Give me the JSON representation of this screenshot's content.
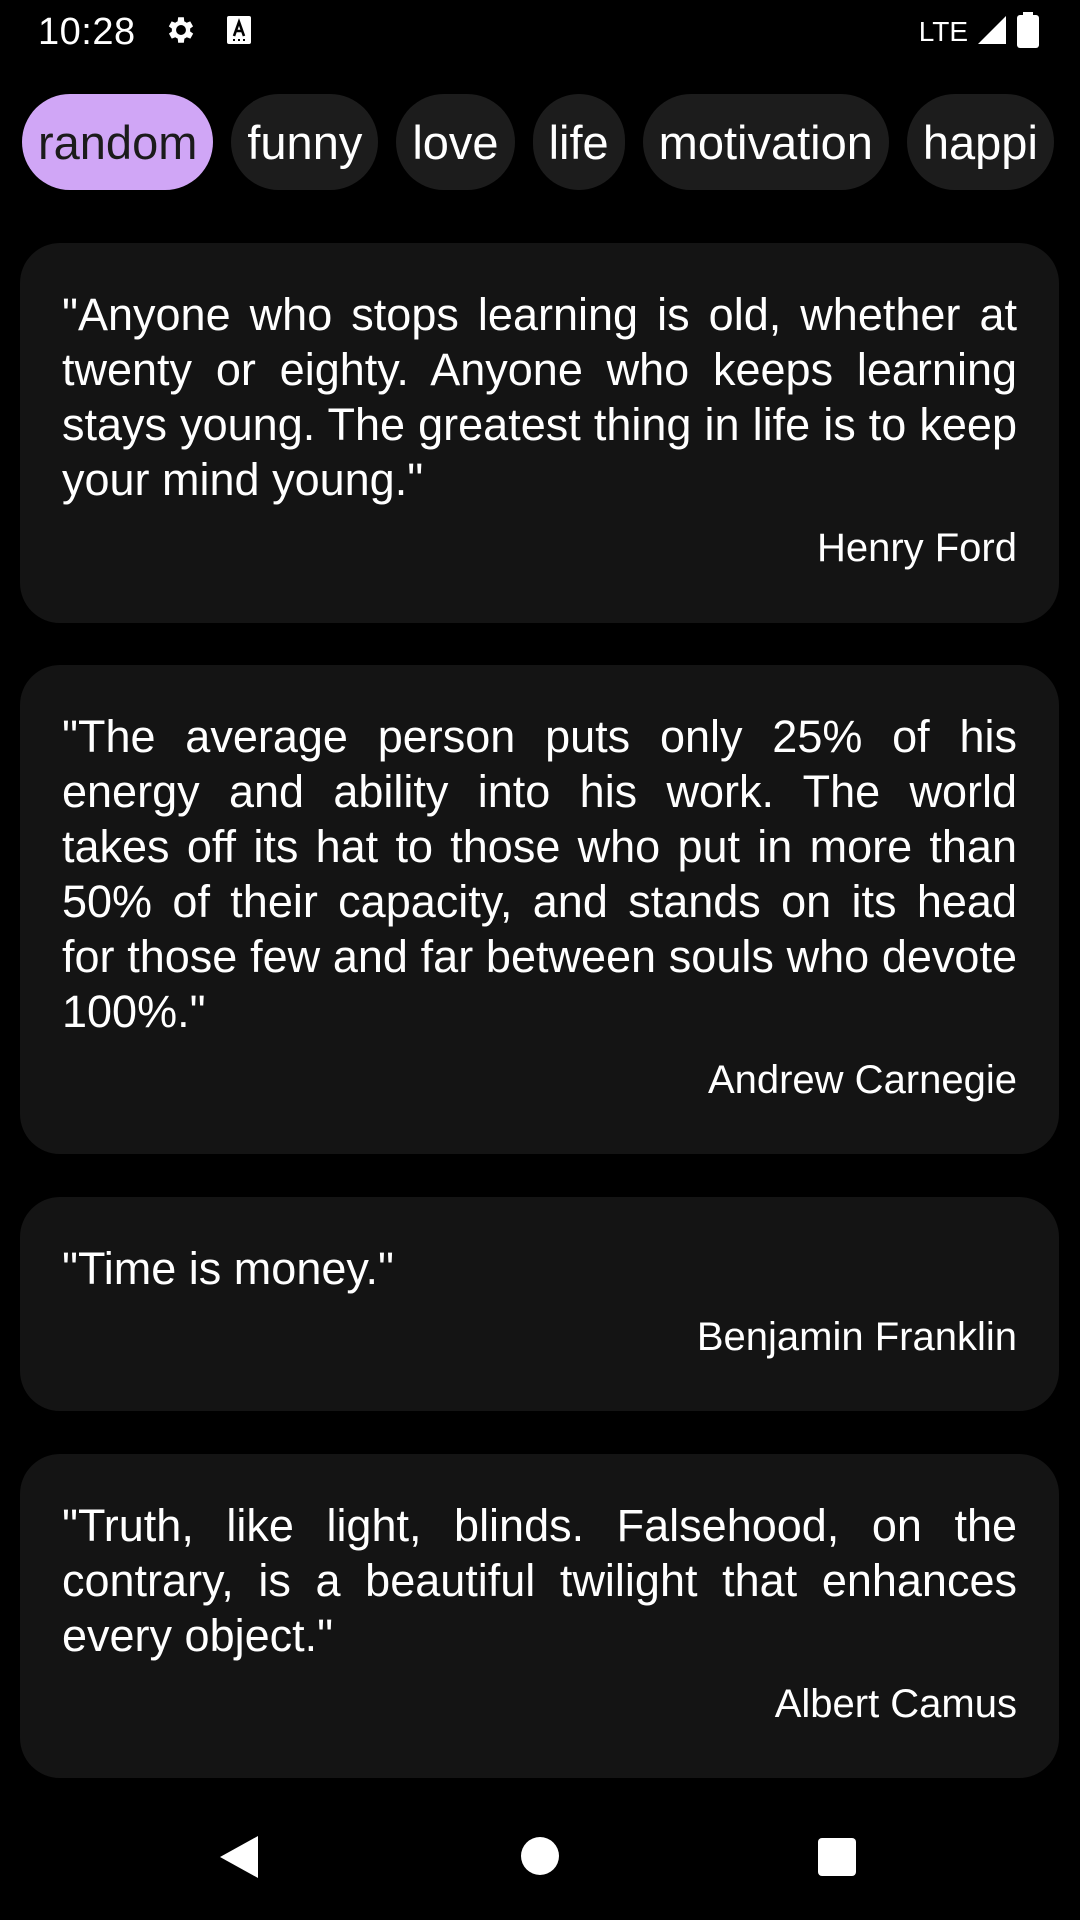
{
  "status_bar": {
    "time": "10:28",
    "network": "LTE"
  },
  "categories": [
    {
      "label": "random",
      "active": true
    },
    {
      "label": "funny",
      "active": false
    },
    {
      "label": "love",
      "active": false
    },
    {
      "label": "life",
      "active": false
    },
    {
      "label": "motivation",
      "active": false
    },
    {
      "label": "happi",
      "active": false
    }
  ],
  "quotes": [
    {
      "text": "\"Anyone who stops learning is old, whether at twenty or eighty. Anyone who keeps learning stays young. The greatest thing in life is to keep your mind young.\"",
      "author": "Henry Ford"
    },
    {
      "text": "\"The average person puts only 25% of his energy and ability into his work. The world takes off its hat to those who put in more than 50% of their capacity, and stands on its head for those few and far between souls who devote 100%.\"",
      "author": "Andrew Carnegie"
    },
    {
      "text": "\"Time is money.\"",
      "author": "Benjamin Franklin"
    },
    {
      "text": "\"Truth, like light, blinds. Falsehood, on the contrary, is a beautiful twilight that enhances every object.\"",
      "author": "Albert Camus"
    }
  ],
  "colors": {
    "background": "#000000",
    "card": "#141414",
    "chip": "#1c1c1c",
    "chip_active": "#d0a6f6"
  },
  "nav": {
    "back_icon": "back-triangle-icon",
    "home_icon": "home-circle-icon",
    "recents_icon": "recents-square-icon"
  }
}
